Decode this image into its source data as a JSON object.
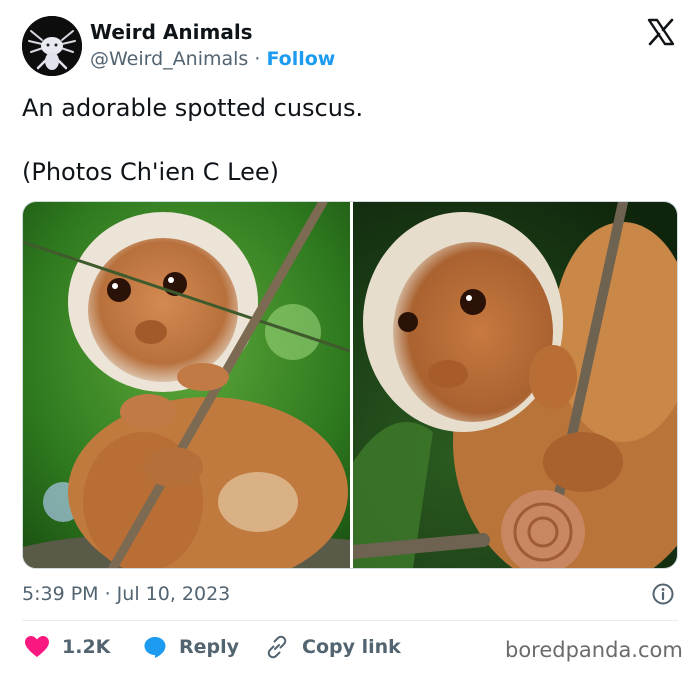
{
  "author": {
    "name": "Weird Animals",
    "handle": "@Weird_Animals",
    "separator": "·",
    "follow_label": "Follow"
  },
  "tweet": {
    "lines": [
      "An adorable spotted cuscus.",
      "(Photos Ch'ien C Lee)"
    ]
  },
  "timestamp": "5:39 PM · Jul 10, 2023",
  "actions": {
    "like_count": "1.2K",
    "reply_label": "Reply",
    "copy_label": "Copy link"
  },
  "watermark": "boredpanda.com",
  "colors": {
    "accent": "#1d9bf0",
    "like": "#f91880",
    "text": "#0f1419",
    "muted": "#536471"
  },
  "icons": {
    "brand": "x-logo-icon",
    "like": "heart-icon",
    "reply": "speech-bubble-icon",
    "copy": "link-icon",
    "info": "info-icon"
  }
}
